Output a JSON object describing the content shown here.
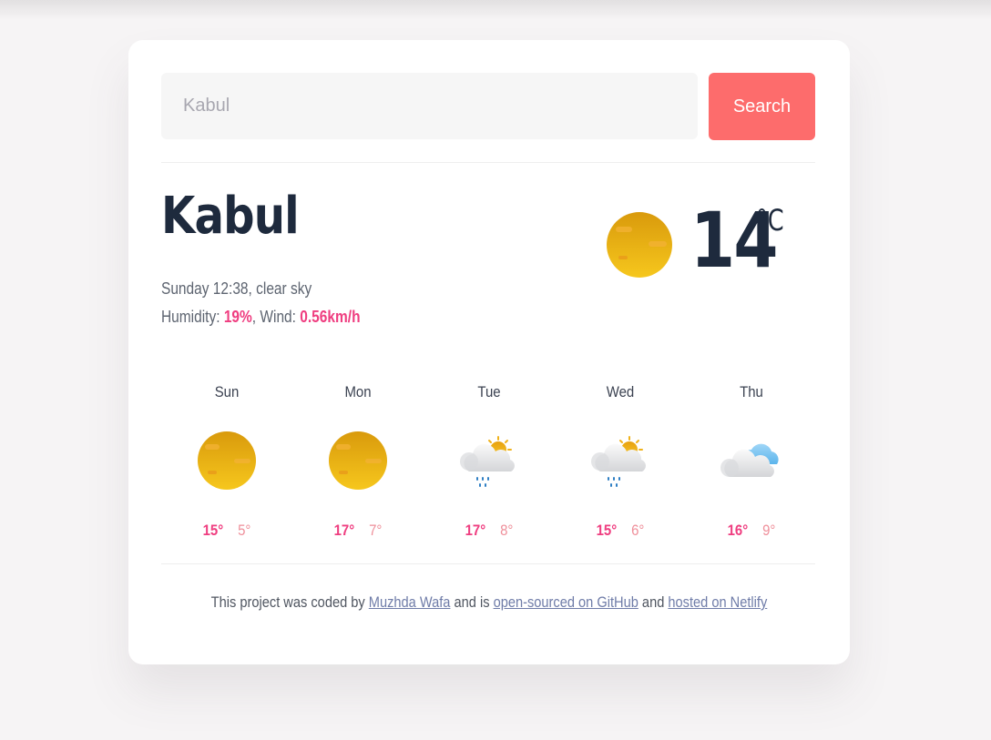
{
  "search": {
    "placeholder": "Kabul",
    "button_label": "Search"
  },
  "current": {
    "city": "Kabul",
    "description": "Sunday 12:38, clear sky",
    "humidity_label": "Humidity: ",
    "humidity_value": "19%",
    "wind_label": ", Wind: ",
    "wind_value": "0.56km/h",
    "temperature": "14",
    "unit": "°C",
    "icon": "sun-icon"
  },
  "forecast": [
    {
      "day": "Sun",
      "icon": "sun-icon",
      "max": "15°",
      "min": "5°"
    },
    {
      "day": "Mon",
      "icon": "sun-icon",
      "max": "17°",
      "min": "7°"
    },
    {
      "day": "Tue",
      "icon": "rain-cloud-sun-icon",
      "max": "17°",
      "min": "8°"
    },
    {
      "day": "Wed",
      "icon": "rain-cloud-sun-icon",
      "max": "15°",
      "min": "6°"
    },
    {
      "day": "Thu",
      "icon": "cloudy-icon",
      "max": "16°",
      "min": "9°"
    }
  ],
  "footer": {
    "prefix": "This project was coded by ",
    "author_link": "Muzhda Wafa",
    "middle": " and is ",
    "github_link": "open-sourced on GitHub",
    "conjunction": " and ",
    "netlify_link": "hosted on Netlify"
  },
  "colors": {
    "accent": "#ef3e80",
    "button": "#fd6c6c",
    "heading": "#1e2a3d",
    "background": "#f6f4f5"
  }
}
